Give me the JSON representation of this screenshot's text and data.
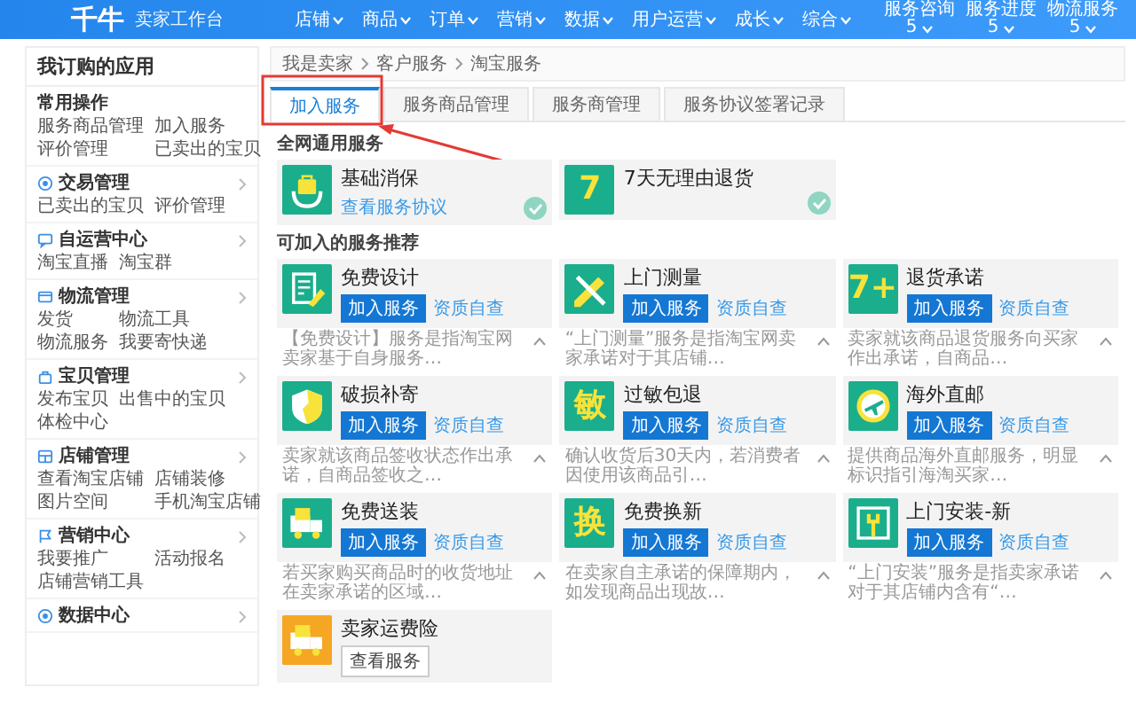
{
  "header": {
    "logo": "千牛",
    "subtitle": "卖家工作台",
    "nav": [
      "店铺",
      "商品",
      "订单",
      "营销",
      "数据",
      "用户运营",
      "成长",
      "综合"
    ],
    "stats": [
      {
        "label": "服务咨询",
        "value": "5"
      },
      {
        "label": "服务进度",
        "value": "5"
      },
      {
        "label": "物流服务",
        "value": "5"
      }
    ]
  },
  "sidebar": {
    "title": "我订购的应用",
    "sections": [
      {
        "title": "常用操作",
        "items": [
          "服务商品管理",
          "加入服务",
          "评价管理",
          "已卖出的宝贝"
        ]
      },
      {
        "title": "交易管理",
        "items": [
          "已卖出的宝贝",
          "评价管理"
        ]
      },
      {
        "title": "自运营中心",
        "items": [
          "淘宝直播",
          "淘宝群"
        ]
      },
      {
        "title": "物流管理",
        "items": [
          "发货",
          "物流工具",
          "物流服务",
          "我要寄快递"
        ]
      },
      {
        "title": "宝贝管理",
        "items": [
          "发布宝贝",
          "出售中的宝贝",
          "体检中心"
        ]
      },
      {
        "title": "店铺管理",
        "items": [
          "查看淘宝店铺",
          "店铺装修",
          "图片空间",
          "手机淘宝店铺"
        ]
      },
      {
        "title": "营销中心",
        "items": [
          "我要推广",
          "活动报名",
          "店铺营销工具"
        ]
      },
      {
        "title": "数据中心"
      }
    ]
  },
  "breadcrumb": [
    "我是卖家",
    "客户服务",
    "淘宝服务"
  ],
  "tabs": [
    {
      "label": "加入服务",
      "selected": true
    },
    {
      "label": "服务商品管理",
      "selected": false
    },
    {
      "label": "服务商管理",
      "selected": false
    },
    {
      "label": "服务协议签署记录",
      "selected": false
    }
  ],
  "annotations": [
    {
      "kind": "box-arrow"
    }
  ],
  "sections": [
    {
      "title": "全网通用服务",
      "cards": [
        {
          "kind": "joined",
          "name": "基础消保",
          "color": "#1aae8c",
          "link": "查看服务协议"
        },
        {
          "kind": "joined",
          "name": "7天无理由退货",
          "glyph": "7",
          "color": "#1aae8c"
        }
      ]
    },
    {
      "title": "可加入的服务推荐",
      "cards": [
        {
          "kind": "recommend",
          "name": "免费设计",
          "color": "#1aae8c",
          "button": "加入服务",
          "link": "资质自查",
          "desc": "【免费设计】服务是指淘宝网卖家基于自身服务…"
        },
        {
          "kind": "recommend",
          "name": "上门测量",
          "color": "#1aae8c",
          "button": "加入服务",
          "link": "资质自查",
          "desc": "“上门测量”服务是指淘宝网卖家承诺对于其店铺…"
        },
        {
          "kind": "recommend",
          "name": "退货承诺",
          "glyph": "7+",
          "color": "#1aae8c",
          "button": "加入服务",
          "link": "资质自查",
          "desc": "卖家就该商品退货服务向买家作出承诺，自商品…"
        },
        {
          "kind": "recommend",
          "name": "破损补寄",
          "color": "#1aae8c",
          "button": "加入服务",
          "link": "资质自查",
          "desc": "卖家就该商品签收状态作出承诺，自商品签收之…"
        },
        {
          "kind": "recommend",
          "name": "过敏包退",
          "glyph": "敏",
          "color": "#1aae8c",
          "button": "加入服务",
          "link": "资质自查",
          "desc": "确认收货后30天内，若消费者因使用该商品引…"
        },
        {
          "kind": "recommend",
          "name": "海外直邮",
          "color": "#1aae8c",
          "button": "加入服务",
          "link": "资质自查",
          "desc": "提供商品海外直邮服务，明显标识指引海淘买家…"
        },
        {
          "kind": "recommend",
          "name": "免费送装",
          "color": "#1aae8c",
          "button": "加入服务",
          "link": "资质自查",
          "desc": "若买家购买商品时的收货地址在卖家承诺的区域…"
        },
        {
          "kind": "recommend",
          "name": "免费换新",
          "glyph": "换",
          "color": "#1aae8c",
          "button": "加入服务",
          "link": "资质自查",
          "desc": "在卖家自主承诺的保障期内，如发现商品出现故…"
        },
        {
          "kind": "recommend",
          "name": "上门安装-新",
          "color": "#1aae8c",
          "button": "加入服务",
          "link": "资质自查",
          "desc": "“上门安装”服务是指卖家承诺对于其店铺内含有“…"
        },
        {
          "kind": "view",
          "name": "卖家运费险",
          "color": "#f5a623",
          "button": "查看服务"
        }
      ]
    }
  ]
}
